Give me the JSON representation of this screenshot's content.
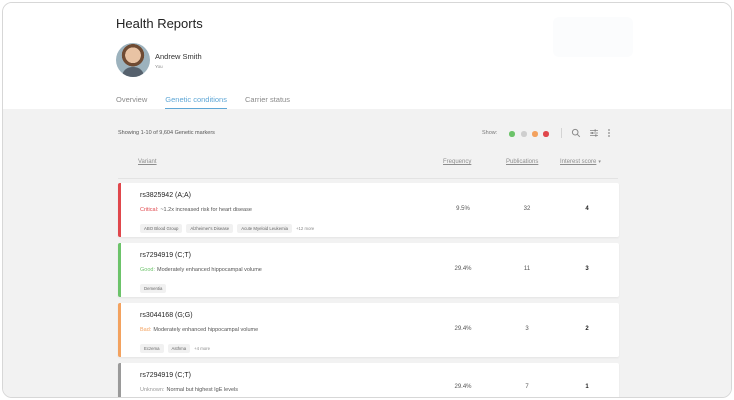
{
  "app": {
    "title": "Health Reports"
  },
  "user": {
    "name": "Andrew Smith",
    "relation": "You"
  },
  "tabs": [
    {
      "label": "Overview",
      "active": false
    },
    {
      "label": "Genetic conditions",
      "active": true
    },
    {
      "label": "Carrier status",
      "active": false
    }
  ],
  "toolbar": {
    "showing": "Showing 1-10 of 9,604 Genetic markers",
    "show_label": "Show:",
    "filter_dots": [
      "#6cc36a",
      "#cfcfcf",
      "#f3a25f",
      "#e0474c"
    ],
    "icons": [
      "search-icon",
      "sliders-icon",
      "more-vertical-icon"
    ]
  },
  "columns": {
    "variant": "Variant",
    "frequency": "Frequency",
    "publications": "Publications",
    "interest_score": "Interest score",
    "sort_caret": "▾"
  },
  "rows": [
    {
      "variant": "rs3825942 (A;A)",
      "severity": "Critical:",
      "severity_color": "#e0474c",
      "description": "~1.2x increased risk for heart disease",
      "tags": [
        "ABO Blood Group",
        "Alzheimer's Disease",
        "Acute Myeloid Leukemia"
      ],
      "more": "+12 more",
      "frequency": "9.5%",
      "publications": "32",
      "score": "4"
    },
    {
      "variant": "rs7294919 (C;T)",
      "severity": "Good:",
      "severity_color": "#6cc36a",
      "description": "Moderately enhanced hippocampal volume",
      "tags": [
        "Dementia"
      ],
      "more": "",
      "frequency": "29.4%",
      "publications": "11",
      "score": "3"
    },
    {
      "variant": "rs3044168 (G;G)",
      "severity": "Bad:",
      "severity_color": "#f3a25f",
      "description": "Moderately enhanced hippocampal volume",
      "tags": [
        "Eczema",
        "Asthma"
      ],
      "more": "+4 more",
      "frequency": "29.4%",
      "publications": "3",
      "score": "2"
    },
    {
      "variant": "rs7294919 (C;T)",
      "severity": "Unknown:",
      "severity_color": "#9a9a9a",
      "description": "Normal but highest IgE levels",
      "tags": [],
      "more": "",
      "frequency": "29.4%",
      "publications": "7",
      "score": "1"
    }
  ]
}
